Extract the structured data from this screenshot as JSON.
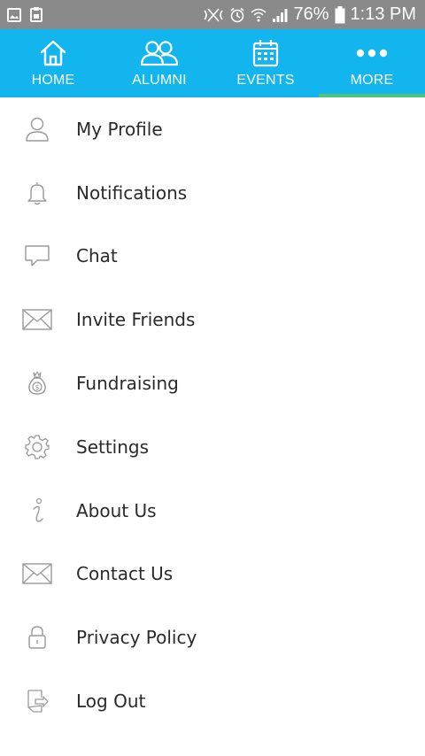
{
  "status_bar": {
    "battery_percent": "76%",
    "time": "1:13 PM"
  },
  "nav": {
    "tabs": [
      {
        "label": "HOME",
        "icon": "home-icon",
        "active": false
      },
      {
        "label": "ALUMNI",
        "icon": "people-icon",
        "active": false
      },
      {
        "label": "EVENTS",
        "icon": "calendar-icon",
        "active": false
      },
      {
        "label": "MORE",
        "icon": "more-dots-icon",
        "active": true
      }
    ]
  },
  "menu": {
    "items": [
      {
        "label": "My Profile",
        "icon": "user-icon"
      },
      {
        "label": "Notifications",
        "icon": "bell-icon"
      },
      {
        "label": "Chat",
        "icon": "chat-bubble-icon"
      },
      {
        "label": "Invite Friends",
        "icon": "envelope-icon"
      },
      {
        "label": "Fundraising",
        "icon": "money-bag-icon"
      },
      {
        "label": "Settings",
        "icon": "gear-icon"
      },
      {
        "label": "About Us",
        "icon": "info-icon"
      },
      {
        "label": "Contact Us",
        "icon": "envelope-icon"
      },
      {
        "label": "Privacy Policy",
        "icon": "lock-icon"
      },
      {
        "label": "Log Out",
        "icon": "logout-icon"
      }
    ]
  },
  "colors": {
    "nav_bg": "#12b5ee",
    "active_underline": "#49c57c",
    "status_bar_bg": "#8a8a8a"
  }
}
